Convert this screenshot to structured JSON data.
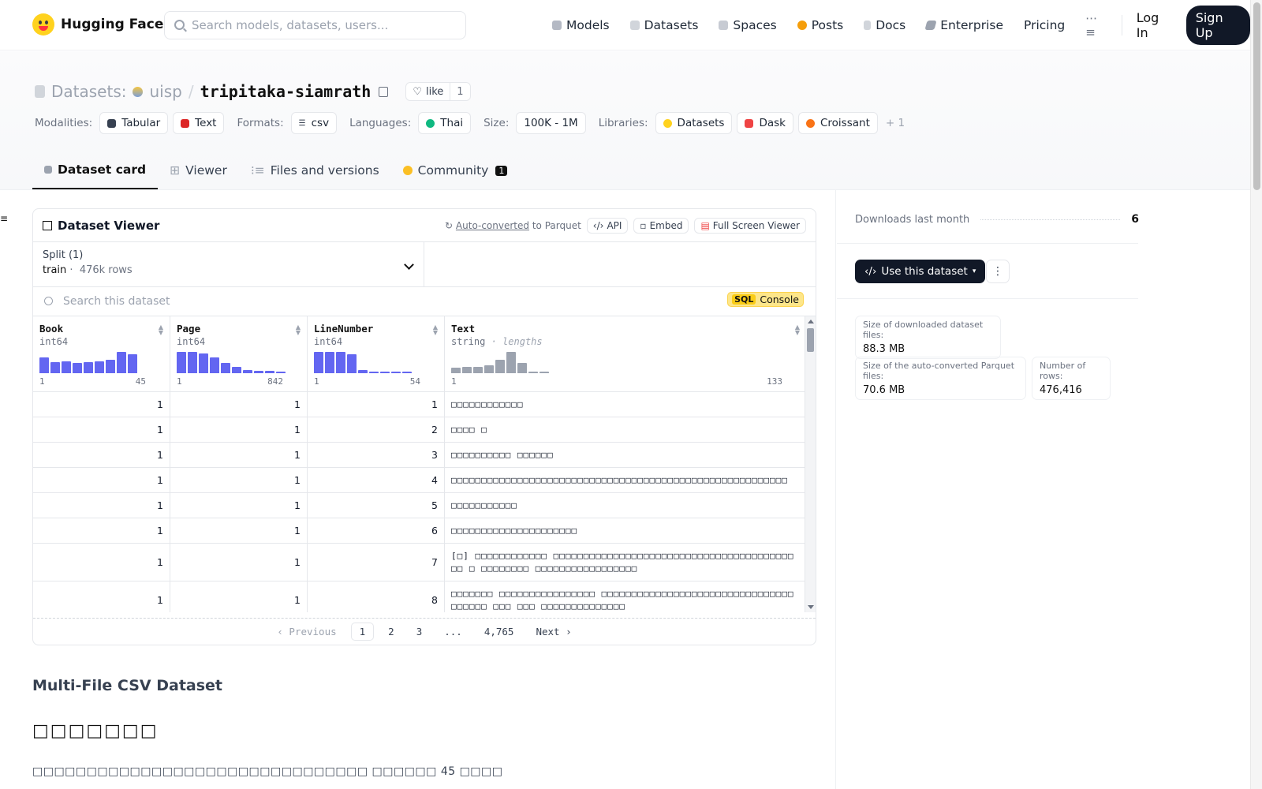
{
  "nav": {
    "brand": "Hugging Face",
    "search_placeholder": "Search models, datasets, users...",
    "links": [
      "Models",
      "Datasets",
      "Spaces",
      "Posts",
      "Docs",
      "Enterprise",
      "Pricing"
    ],
    "login": "Log In",
    "signup": "Sign Up"
  },
  "header": {
    "section": "Datasets:",
    "owner": "uisp",
    "repo": "tripitaka-siamrath",
    "like_label": "like",
    "like_count": "1",
    "modalities_label": "Modalities:",
    "modalities": [
      "Tabular",
      "Text"
    ],
    "formats_label": "Formats:",
    "formats": [
      "csv"
    ],
    "languages_label": "Languages:",
    "languages": [
      "Thai"
    ],
    "size_label": "Size:",
    "size": "100K - 1M",
    "libraries_label": "Libraries:",
    "libraries": [
      "Datasets",
      "Dask",
      "Croissant"
    ],
    "more": "+ 1"
  },
  "tabs": {
    "dataset_card": "Dataset card",
    "viewer": "Viewer",
    "files": "Files and versions",
    "community": "Community",
    "community_count": "1"
  },
  "viewer": {
    "title": "Dataset Viewer",
    "autoconverted": "Auto-converted",
    "to_parquet": "to Parquet",
    "api": "API",
    "embed": "Embed",
    "fullscreen": "Full Screen Viewer",
    "split_label": "Split (1)",
    "split_value": "train",
    "split_rows": "476k rows",
    "search_placeholder": "Search this dataset",
    "sql": "SQL",
    "console": "Console",
    "columns": [
      {
        "name": "Book",
        "type": "int64",
        "min": "1",
        "max": "45",
        "hist": [
          0.7,
          0.5,
          0.55,
          0.45,
          0.5,
          0.55,
          0.6,
          0.95,
          0.85
        ],
        "color": "#6366f1"
      },
      {
        "name": "Page",
        "type": "int64",
        "min": "1",
        "max": "842",
        "hist": [
          0.95,
          0.95,
          0.9,
          0.7,
          0.45,
          0.3,
          0.15,
          0.1,
          0.1,
          0.05
        ],
        "color": "#6366f1"
      },
      {
        "name": "LineNumber",
        "type": "int64",
        "min": "1",
        "max": "54",
        "hist": [
          0.95,
          0.95,
          0.95,
          0.85,
          0.15,
          0.05,
          0.05,
          0.05,
          0.05
        ],
        "color": "#6366f1"
      },
      {
        "name": "Text",
        "type": "string",
        "type_extra": "· lengths",
        "min": "1",
        "max": "133",
        "hist": [
          0.25,
          0.3,
          0.3,
          0.35,
          0.6,
          0.95,
          0.45,
          0.05,
          0.05
        ],
        "color": "#9ca3af"
      }
    ],
    "rows": [
      {
        "book": "1",
        "page": "1",
        "line": "1",
        "text": "□□□□□□□□□□□□",
        "h": 32
      },
      {
        "book": "1",
        "page": "1",
        "line": "2",
        "text": "□□□□ □",
        "h": 32
      },
      {
        "book": "1",
        "page": "1",
        "line": "3",
        "text": "□□□□□□□□□□ □□□□□□",
        "h": 32
      },
      {
        "book": "1",
        "page": "1",
        "line": "4",
        "text": "□□□□□□□□□□□□□□□□□□□□□□□□□□□□□□□□□□□□□□□□□□□□□□□□□□□□□□□□",
        "h": 32
      },
      {
        "book": "1",
        "page": "1",
        "line": "5",
        "text": "□□□□□□□□□□□",
        "h": 32
      },
      {
        "book": "1",
        "page": "1",
        "line": "6",
        "text": "□□□□□□□□□□□□□□□□□□□□□",
        "h": 32
      },
      {
        "book": "1",
        "page": "1",
        "line": "7",
        "text": "[□] □□□□□□□□□□□□ □□□□□□□□□□□□□□□□□□□□□□□□□□□□□□□□□□□□□□□□□□ □ □□□□□□□□ □□□□□□□□□□□□□□□□□",
        "h": 48
      },
      {
        "book": "1",
        "page": "1",
        "line": "8",
        "text": "□□□□□□□ □□□□□□□□□□□□□□□□ □□□□□□□□□□□□□□□□□□□□□□□□□□□□□□□□□□□□□□ □□□ □□□ □□□□□□□□□□□□□□",
        "h": 48
      }
    ],
    "pager": {
      "previous": "Previous",
      "pages": [
        "1",
        "2",
        "3",
        "...",
        "4,765"
      ],
      "next": "Next"
    }
  },
  "readme": {
    "h2": "Multi-File CSV Dataset",
    "h1": "□□□□□□□",
    "p": "□□□□□□□□□□□□□□□□□□□□□□□□□□□□□□□ □□□□□□ 45 □□□□"
  },
  "sidebar": {
    "downloads_label": "Downloads last month",
    "downloads_value": "6",
    "use_button": "Use this dataset",
    "stats": [
      {
        "k": "Size of downloaded dataset files:",
        "v": "88.3 MB"
      },
      {
        "k": "Size of the auto-converted Parquet files:",
        "v": "70.6 MB"
      },
      {
        "k": "Number of rows:",
        "v": "476,416"
      }
    ]
  },
  "colors": {
    "accent": "#6366f1",
    "dark": "#111827",
    "sql": "#fde68a"
  }
}
